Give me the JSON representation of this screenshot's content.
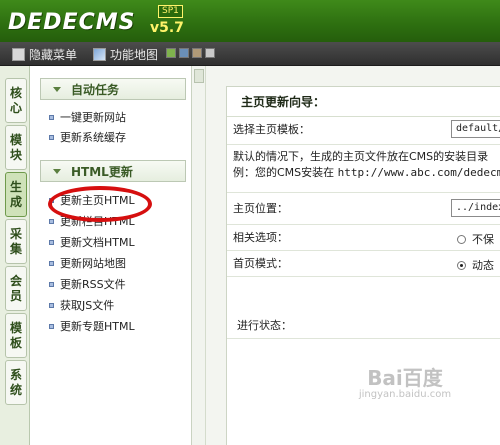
{
  "header": {
    "logo_text": "DEDECMS",
    "version": "v5.7",
    "service_pack": "SP1"
  },
  "menubar": {
    "items": [
      "隐藏菜单",
      "功能地图"
    ]
  },
  "left_tabs": [
    "核心",
    "模块",
    "生成",
    "采集",
    "会员",
    "模板",
    "系统"
  ],
  "sidebar": {
    "sections": [
      {
        "title": "自动任务",
        "items": [
          "一键更新网站",
          "更新系统缓存"
        ]
      },
      {
        "title": "HTML更新",
        "items": [
          "更新主页HTML",
          "更新栏目HTML",
          "更新文档HTML",
          "更新网站地图",
          "更新RSS文件",
          "获取JS文件",
          "更新专题HTML"
        ]
      }
    ]
  },
  "panel": {
    "title": "主页更新向导：",
    "template_label": "选择主页模板：",
    "template_value": "default/",
    "desc_line1": "默认的情况下，生成的主页文件放在CMS的安装目录",
    "desc_line2_prefix": "例：您的CMS安装在",
    "desc_line2_url": "http://www.abc.com/dedecms/",
    "position_label": "主页位置：",
    "position_value": "../index.html",
    "related_label": "相关选项：",
    "related_option": "不保",
    "mode_label": "首页模式：",
    "mode_option": "动态",
    "status_label": "进行状态："
  },
  "watermark": {
    "text": "Bai百度",
    "sub": "jingyan.baidu.com"
  }
}
